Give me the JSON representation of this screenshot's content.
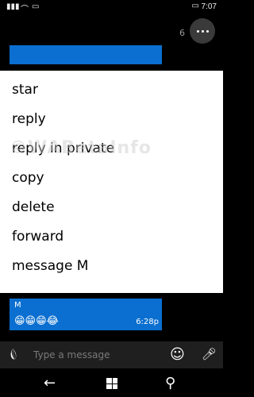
{
  "status": {
    "time": "7:07"
  },
  "chat": {
    "count": "6",
    "message": {
      "sender": "M",
      "emojis": "😁😁😁😂",
      "time": "6:28p"
    }
  },
  "menu": {
    "items": [
      {
        "label": "star"
      },
      {
        "label": "reply"
      },
      {
        "label": "reply in private"
      },
      {
        "label": "copy"
      },
      {
        "label": "delete"
      },
      {
        "label": "forward"
      },
      {
        "label": "message M"
      }
    ]
  },
  "watermark": "©WABetaInfo",
  "input": {
    "placeholder": "Type a message"
  },
  "icons": {
    "attach": "paperclip-icon",
    "emoji": "smiley-icon",
    "mic": "microphone-icon",
    "back": "back-arrow-icon",
    "start": "windows-start-icon",
    "search": "search-icon",
    "more": "more-icon"
  },
  "colors": {
    "accent": "#0a6fd0",
    "menu_bg": "#ffffff",
    "background": "#000000"
  }
}
